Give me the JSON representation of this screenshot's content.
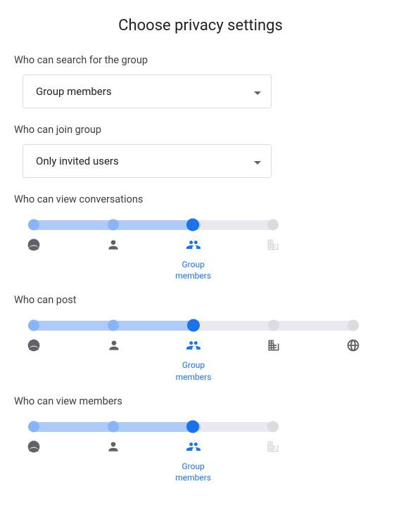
{
  "title": "Choose privacy settings",
  "search": {
    "label": "Who can search for the group",
    "value": "Group members"
  },
  "join": {
    "label": "Who can join group",
    "value": "Only invited users"
  },
  "sliders": {
    "view_conv": {
      "label": "Who can view conversations",
      "stops": 4,
      "selected": 2,
      "selected_label": "Group\nmembers",
      "icons": [
        "owner",
        "manager",
        "group",
        "org"
      ],
      "last_disabled": true
    },
    "post": {
      "label": "Who can post",
      "stops": 5,
      "selected": 2,
      "selected_label": "Group\nmembers",
      "icons": [
        "owner",
        "manager",
        "group",
        "org",
        "web"
      ],
      "last_disabled": false
    },
    "view_members": {
      "label": "Who can view members",
      "stops": 4,
      "selected": 2,
      "selected_label": "Group\nmembers",
      "icons": [
        "owner",
        "manager",
        "group",
        "org"
      ],
      "last_disabled": true
    }
  }
}
